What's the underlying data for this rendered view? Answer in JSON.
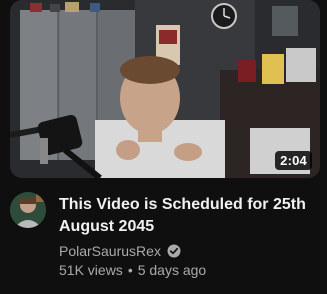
{
  "video": {
    "duration": "2:04",
    "title": "This Video is Scheduled for 25th August 2045",
    "channel": "PolarSaurusRex",
    "views": "51K views",
    "separator": "•",
    "age": "5 days ago"
  },
  "icons": {
    "verified": "verified-check-icon",
    "avatar": "channel-avatar"
  },
  "colors": {
    "background": "#0f0f0f",
    "title": "#f1f1f1",
    "secondary_text": "#aaaaaa",
    "duration_badge": "#000000"
  }
}
